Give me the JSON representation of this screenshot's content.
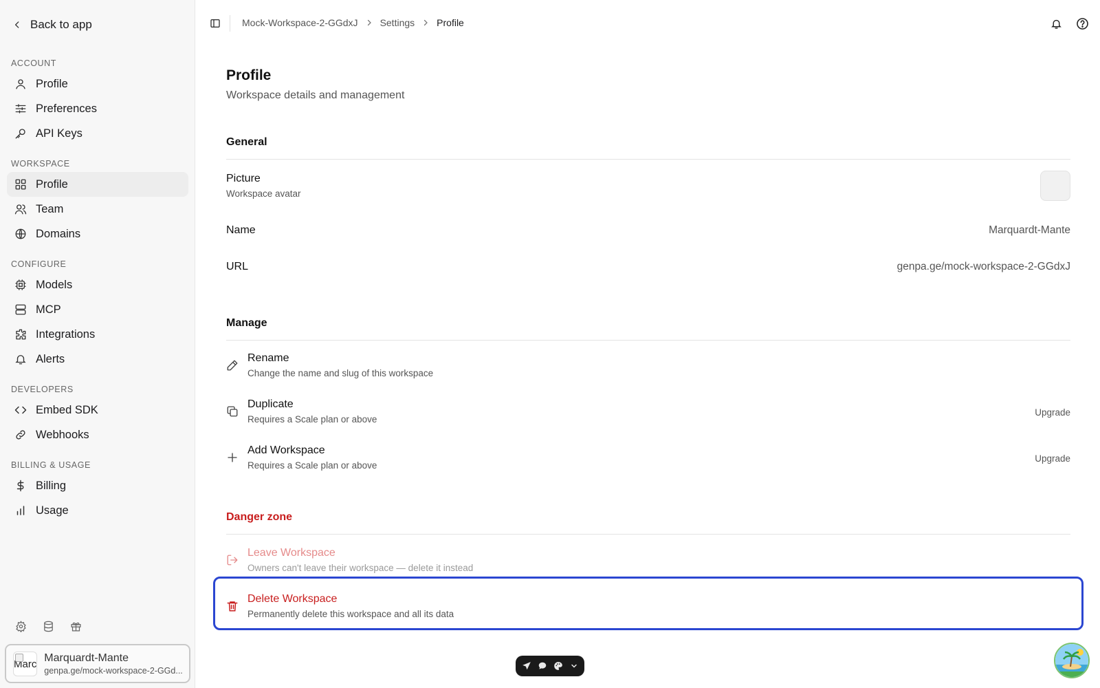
{
  "sidebar": {
    "back_label": "Back to app",
    "sections": [
      {
        "label": "ACCOUNT",
        "items": [
          {
            "label": "Profile",
            "icon": "user-icon"
          },
          {
            "label": "Preferences",
            "icon": "sliders-icon"
          },
          {
            "label": "API Keys",
            "icon": "key-icon"
          }
        ]
      },
      {
        "label": "WORKSPACE",
        "items": [
          {
            "label": "Profile",
            "icon": "grid-icon",
            "active": true
          },
          {
            "label": "Team",
            "icon": "users-icon"
          },
          {
            "label": "Domains",
            "icon": "globe-icon"
          }
        ]
      },
      {
        "label": "CONFIGURE",
        "items": [
          {
            "label": "Models",
            "icon": "cpu-icon"
          },
          {
            "label": "MCP",
            "icon": "server-icon"
          },
          {
            "label": "Integrations",
            "icon": "puzzle-icon"
          },
          {
            "label": "Alerts",
            "icon": "bell-icon"
          }
        ]
      },
      {
        "label": "DEVELOPERS",
        "items": [
          {
            "label": "Embed SDK",
            "icon": "code-icon"
          },
          {
            "label": "Webhooks",
            "icon": "link-icon"
          }
        ]
      },
      {
        "label": "BILLING & USAGE",
        "items": [
          {
            "label": "Billing",
            "icon": "dollar-icon"
          },
          {
            "label": "Usage",
            "icon": "bar-chart-icon"
          }
        ]
      }
    ],
    "workspace_card": {
      "avatar_alt": "Marc",
      "name": "Marquardt-Mante",
      "url": "genpa.ge/mock-workspace-2-GGd..."
    }
  },
  "breadcrumb": {
    "workspace": "Mock-Workspace-2-GGdxJ",
    "settings": "Settings",
    "current": "Profile"
  },
  "page": {
    "title": "Profile",
    "subtitle": "Workspace details and management"
  },
  "general": {
    "heading": "General",
    "picture_label": "Picture",
    "picture_desc": "Workspace avatar",
    "name_label": "Name",
    "name_value": "Marquardt-Mante",
    "url_label": "URL",
    "url_value": "genpa.ge/mock-workspace-2-GGdxJ"
  },
  "manage": {
    "heading": "Manage",
    "rename_title": "Rename",
    "rename_desc": "Change the name and slug of this workspace",
    "duplicate_title": "Duplicate",
    "duplicate_desc": "Requires a Scale plan or above",
    "duplicate_action": "Upgrade",
    "add_title": "Add Workspace",
    "add_desc": "Requires a Scale plan or above",
    "add_action": "Upgrade"
  },
  "danger": {
    "heading": "Danger zone",
    "leave_title": "Leave Workspace",
    "leave_desc": "Owners can't leave their workspace — delete it instead",
    "delete_title": "Delete Workspace",
    "delete_desc": "Permanently delete this workspace and all its data"
  },
  "colors": {
    "danger": "#c81e1e",
    "focus_ring": "#2b46d1",
    "sidebar_bg": "#f7f7f7"
  }
}
